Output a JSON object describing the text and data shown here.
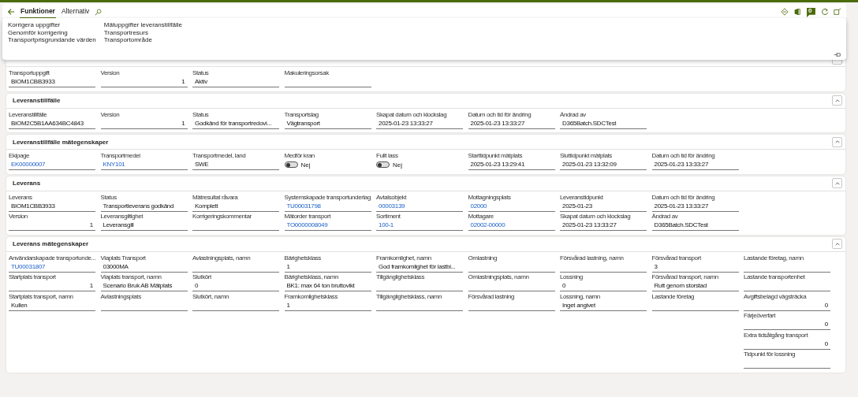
{
  "toolbar": {
    "tabs": [
      {
        "label": "Funktioner",
        "selected": true
      },
      {
        "label": "Alternativ",
        "selected": false
      }
    ],
    "notification_count": "0"
  },
  "menu_panel": {
    "columns": [
      [
        "Korrigera uppgifter",
        "Genomför korrigering",
        "Transportprisgrundande värden"
      ],
      [
        "Mätuppgifter leveranstillfälle",
        "Transportresurs",
        "Transportområde"
      ]
    ]
  },
  "sections": [
    {
      "expanded": true,
      "columns": [
        [
          {
            "label": "Transportuppgift",
            "kind": "text",
            "value": "BIOM1CBB3933"
          }
        ],
        [
          {
            "label": "Version",
            "kind": "number",
            "value": "1"
          }
        ],
        [
          {
            "label": "Status",
            "kind": "text",
            "value": "Aktiv"
          }
        ],
        [
          {
            "label": "Makuleringsorsak",
            "kind": "text"
          }
        ]
      ]
    },
    {
      "title": "Leveranstillfälle",
      "expanded": true,
      "columns": [
        [
          {
            "label": "Leveranstillfälle",
            "kind": "text",
            "value": "BIOM2C5B1AA634BC4843"
          }
        ],
        [
          {
            "label": "Version",
            "kind": "number",
            "value": "1"
          }
        ],
        [
          {
            "label": "Status",
            "kind": "text",
            "value": "Godkänd för transportredovi..."
          }
        ],
        [
          {
            "label": "Transportslag",
            "kind": "text",
            "value": "Vägtransport"
          }
        ],
        [
          {
            "label": "Skapat datum och klockslag",
            "kind": "text",
            "value": "2025-01-23 13:33:27"
          }
        ],
        [
          {
            "label": "Datum och tid för ändring",
            "kind": "text",
            "value": "2025-01-23 13:33:27"
          }
        ],
        [
          {
            "label": "Ändrad av",
            "kind": "text",
            "value": "D365Batch.SDCTest"
          }
        ]
      ]
    },
    {
      "title": "Leveranstillfälle mätegenskaper",
      "expanded": true,
      "columns": [
        [
          {
            "label": "Ekipage",
            "kind": "link",
            "value": "EK00000007"
          }
        ],
        [
          {
            "label": "Transportmedel",
            "kind": "link",
            "value": "KNY101"
          }
        ],
        [
          {
            "label": "Transportmedel, land",
            "kind": "text",
            "value": "SWE"
          }
        ],
        [
          {
            "label": "Medför kran",
            "kind": "toggle",
            "on": false,
            "value": "Nej"
          }
        ],
        [
          {
            "label": "Fullt lass",
            "kind": "toggle",
            "on": false,
            "value": "Nej"
          }
        ],
        [
          {
            "label": "Starttidpunkt mätplats",
            "kind": "text",
            "value": "2025-01-23 13:29:41"
          }
        ],
        [
          {
            "label": "Sluttidpunkt mätplats",
            "kind": "text",
            "value": "2025-01-23 13:32:09"
          }
        ],
        [
          {
            "label": "Datum och tid för ändring",
            "kind": "text",
            "value": "2025-01-23 13:33:27"
          }
        ]
      ]
    },
    {
      "title": "Leverans",
      "expanded": true,
      "columns": [
        [
          {
            "label": "Leverans",
            "kind": "text",
            "value": "BIOM1CBB3933"
          },
          {
            "label": "Version",
            "kind": "number",
            "value": "1"
          }
        ],
        [
          {
            "label": "Status",
            "kind": "text",
            "value": "Transportleverans godkänd"
          },
          {
            "label": "Leveransgiltighet",
            "kind": "text",
            "value": "Leveransgill"
          }
        ],
        [
          {
            "label": "Mätresultat råvara",
            "kind": "text",
            "value": "Komplett"
          },
          {
            "label": "Korrigeringskommentar",
            "kind": "text"
          }
        ],
        [
          {
            "label": "Systemskapade transportunderlag",
            "kind": "link",
            "value": "TU00031798"
          },
          {
            "label": "Mätorder transport",
            "kind": "link",
            "value": "TO0000008049"
          }
        ],
        [
          {
            "label": "Avtalsobjekt",
            "kind": "link",
            "value": "00003139"
          },
          {
            "label": "Sortiment",
            "kind": "link",
            "value": "100-1"
          }
        ],
        [
          {
            "label": "Mottagningsplats",
            "kind": "link",
            "value": "02000"
          },
          {
            "label": "Mottagare",
            "kind": "link",
            "value": "02002-00000"
          }
        ],
        [
          {
            "label": "Leveranstidpunkt",
            "kind": "text",
            "value": "2025-01-23"
          },
          {
            "label": "Skapat datum och klockslag",
            "kind": "text",
            "value": "2025-01-23 13:33:27"
          }
        ],
        [
          {
            "label": "Datum och tid för ändring",
            "kind": "text",
            "value": "2025-01-23 13:33:27"
          },
          {
            "label": "Ändrad av",
            "kind": "text",
            "value": "D365Batch.SDCTest"
          }
        ]
      ]
    },
    {
      "title": "Leverans mätegenskaper",
      "expanded": true,
      "columns": [
        [
          {
            "label": "Användarskapade transportunde...",
            "kind": "link",
            "value": "TU00031807"
          },
          {
            "label": "Startplats transport",
            "kind": "number",
            "value": "1"
          },
          {
            "label": "Startplats transport, namn",
            "kind": "text",
            "value": "Kullen"
          }
        ],
        [
          {
            "label": "Viaplats Transport",
            "kind": "text",
            "value": "03000MA"
          },
          {
            "label": "Viaplats transport, namn",
            "kind": "text",
            "value": "Scenario Bruk AB Mätplats"
          },
          {
            "label": "Avlastningsplats",
            "kind": "text"
          }
        ],
        [
          {
            "label": "Avlastningsplats, namn",
            "kind": "text"
          },
          {
            "label": "Slutkört",
            "kind": "text",
            "value": "0"
          },
          {
            "label": "Slutkört, namn",
            "kind": "text"
          }
        ],
        [
          {
            "label": "Bärighetsklass",
            "kind": "text",
            "value": "1"
          },
          {
            "label": "Bärighetsklass, namn",
            "kind": "text",
            "value": "BK1: max 64 ton bruttovikt"
          },
          {
            "label": "Framkomlighetsklass",
            "kind": "text",
            "value": "1"
          }
        ],
        [
          {
            "label": "Framkomlighet, namn",
            "kind": "text",
            "value": "God framkomlighet för lastbi..."
          },
          {
            "label": "Tillgänglighetsklass",
            "kind": "text"
          },
          {
            "label": "Tillgänglighetsklass, namn",
            "kind": "text"
          }
        ],
        [
          {
            "label": "Omlastning",
            "kind": "text"
          },
          {
            "label": "Omlastningsplats, namn",
            "kind": "text"
          },
          {
            "label": "Försvårad lastning",
            "kind": "text"
          }
        ],
        [
          {
            "label": "Försvårad lastning, namn",
            "kind": "text"
          },
          {
            "label": "Lossning",
            "kind": "text",
            "value": "0"
          },
          {
            "label": "Lossning, namn",
            "kind": "text",
            "value": "Inget angivet"
          }
        ],
        [
          {
            "label": "Försvårad transport",
            "kind": "text",
            "value": "3"
          },
          {
            "label": "Försvårad transport, namn",
            "kind": "text",
            "value": "Rutt genom storstad"
          },
          {
            "label": "Lastande företag",
            "kind": "text"
          }
        ],
        [
          {
            "label": "Lastande företag, namn",
            "kind": "text"
          },
          {
            "label": "Lastande transportenhet",
            "kind": "text"
          },
          {
            "label": "Avgiftsbelagd vägsträcka",
            "kind": "number",
            "value": "0"
          },
          {
            "label": "Färjeöverfart",
            "kind": "number",
            "value": "0"
          },
          {
            "label": "Extra tidsåtgång transport",
            "kind": "number",
            "value": "0"
          },
          {
            "label": "Tidpunkt för lossning",
            "kind": "text"
          }
        ]
      ]
    }
  ]
}
